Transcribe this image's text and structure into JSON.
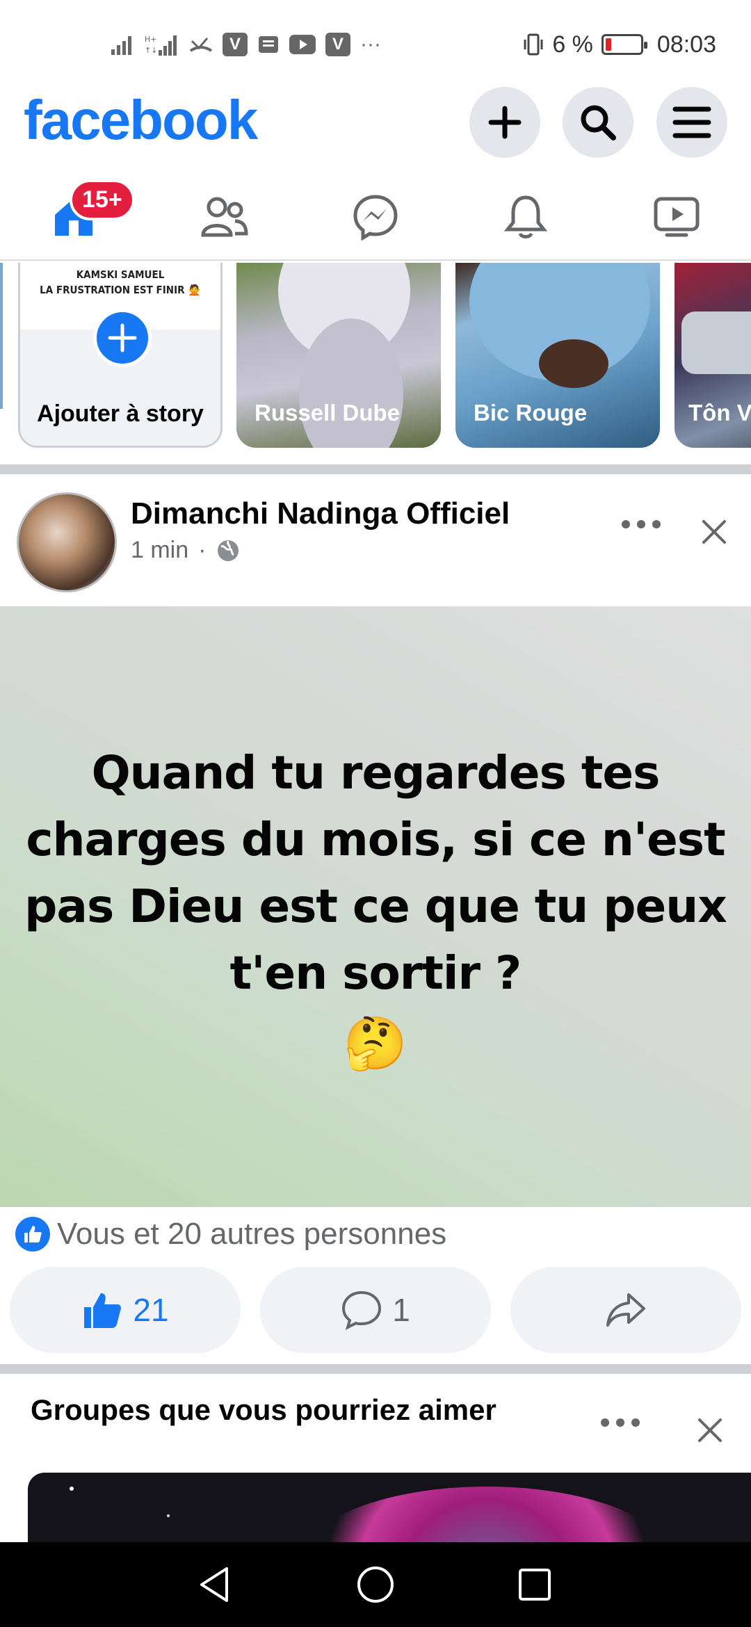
{
  "status_bar": {
    "left_icons": [
      "signal-icon",
      "signal-hplus-icon",
      "mail-icon",
      "vpn-v-icon",
      "message-icon",
      "youtube-icon",
      "vpn-v-icon",
      "more-icon"
    ],
    "more_label": "···",
    "battery_percent": "6 %",
    "time": "08:03"
  },
  "header": {
    "logo": "facebook",
    "buttons": [
      "create-icon",
      "search-icon",
      "menu-icon"
    ]
  },
  "tabs": {
    "home_badge": "15+",
    "items": [
      "home",
      "friends",
      "messenger",
      "notifications",
      "watch"
    ]
  },
  "stories": {
    "add": {
      "overlay_line1": "KAMSKI SAMUEL",
      "overlay_line2": "LA FRUSTRATION EST FINIR 🙅",
      "label": "Ajouter à story"
    },
    "items": [
      {
        "name": "Russell Dube"
      },
      {
        "name": "Bic Rouge"
      },
      {
        "name": "Tôn Vitâm"
      }
    ]
  },
  "post": {
    "author": "Dimanchi Nadinga Officiel",
    "time": "1 min",
    "separator": "·",
    "text": "Quand tu regardes tes charges du mois, si ce n'est pas Dieu est ce que tu peux t'en sortir ?",
    "emoji": "🤔",
    "reactions_text": "Vous et 20 autres personnes",
    "like_count": "21",
    "comment_count": "1"
  },
  "groups": {
    "title": "Groupes que vous pourriez aimer"
  },
  "colors": {
    "brand": "#1877f2",
    "badge": "#e41e3f",
    "post_gradient_start": "#bcd7b0",
    "post_gradient_end": "#dfe0e0"
  }
}
